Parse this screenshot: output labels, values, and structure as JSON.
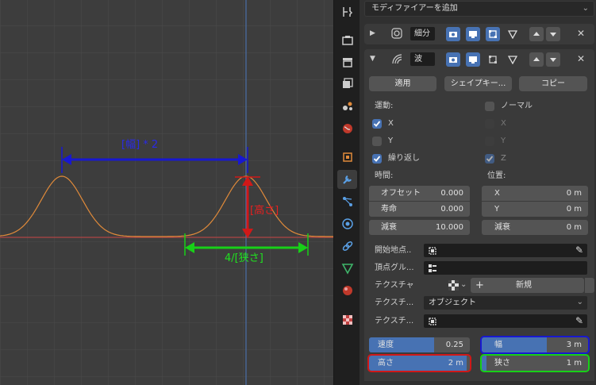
{
  "viewport": {
    "annotations": {
      "width_label": "[幅] * 2",
      "height_label": "[高さ]",
      "narrow_label": "4/[狭さ]"
    },
    "colors": {
      "blue": "#1818d0",
      "red": "#d01818",
      "green": "#18d018",
      "curve": "#e08a3a",
      "axis_x": "#b04646",
      "axis_y": "#4a6fa8"
    }
  },
  "tabs": [
    "tool-icon",
    "render-icon",
    "output-icon",
    "view-layer-icon",
    "scene-icon",
    "world-icon",
    "object-icon",
    "modifier-icon",
    "particles-icon",
    "physics-icon",
    "constraints-icon",
    "data-icon",
    "material-icon",
    "texture-icon"
  ],
  "panel": {
    "add_modifier": "モディファイアーを追加",
    "subdiv": {
      "name": "細分"
    },
    "wave": {
      "name": "波",
      "apply_label": "適用",
      "shape_key_label": "シェイプキー...",
      "copy_label": "コピー",
      "motion_label": "運動:",
      "x_label": "X",
      "y_label": "Y",
      "cyclic_label": "繰り返し",
      "normal_label": "ノーマル",
      "nx_label": "X",
      "ny_label": "Y",
      "nz_label": "Z",
      "time_label": "時間:",
      "position_label": "位置:",
      "offset_label": "オフセット",
      "offset_value": "0.000",
      "life_label": "寿命",
      "life_value": "0.000",
      "damp_label": "減衰",
      "damp_value": "10.000",
      "pos_x_label": "X",
      "pos_x_value": "0 m",
      "pos_y_label": "Y",
      "pos_y_value": "0 m",
      "falloff_label": "減衰",
      "falloff_value": "0 m",
      "start_pos_label": "開始地点..",
      "vertex_group_label": "頂点グル...",
      "texture_label": "テクスチャ",
      "new_label": "新規",
      "texture_coords_label": "テクスチ...",
      "texture_coords_value": "オブジェクト",
      "texture_obj_label": "テクスチ...",
      "speed_label": "速度",
      "speed_value": "0.25",
      "width_label": "幅",
      "width_value": "3 m",
      "height_label": "高さ",
      "height_value": "2 m",
      "narrow_label": "狭さ",
      "narrow_value": "1 m"
    }
  }
}
